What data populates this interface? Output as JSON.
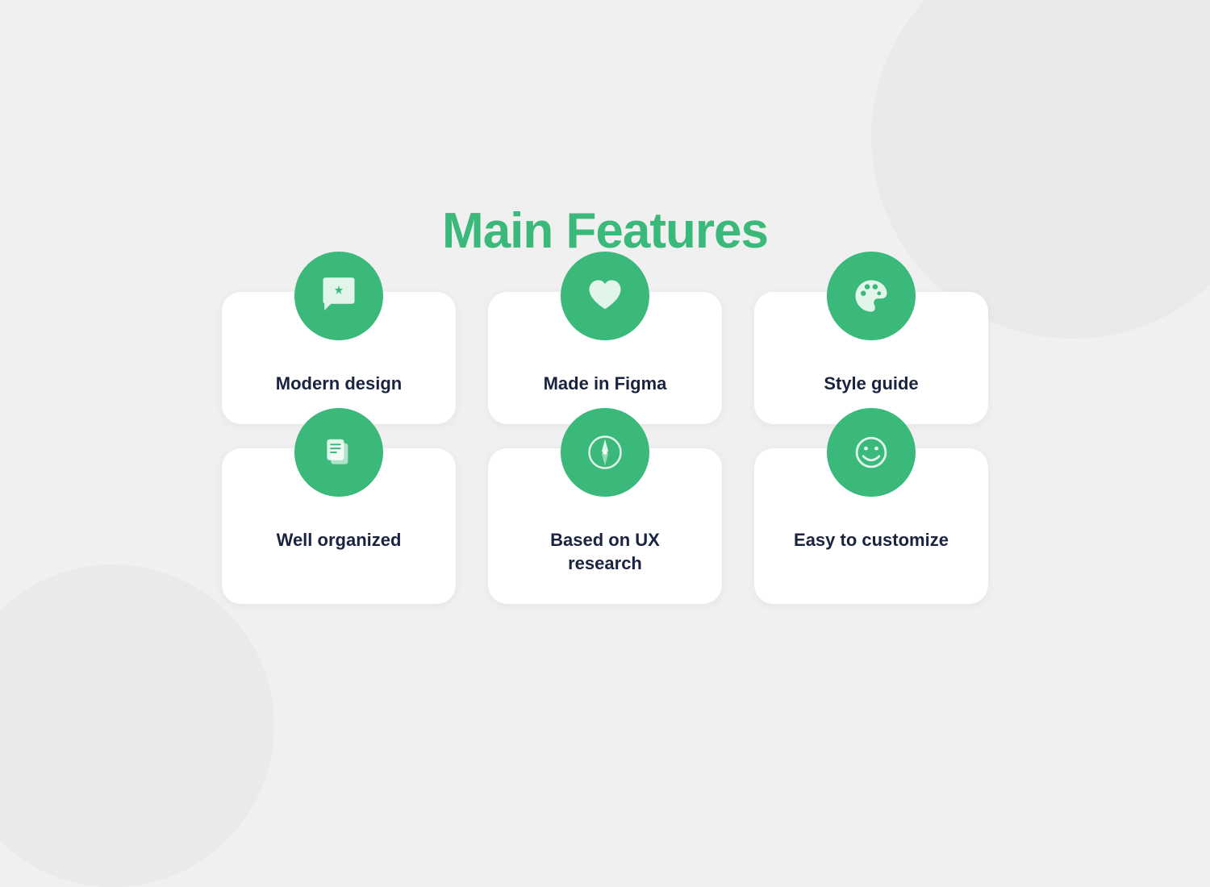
{
  "page": {
    "title": "Main Features",
    "accent_color": "#3ab97a",
    "features": [
      {
        "id": "modern-design",
        "label": "Modern design",
        "icon": "sparkle-chat"
      },
      {
        "id": "made-in-figma",
        "label": "Made in Figma",
        "icon": "heart"
      },
      {
        "id": "style-guide",
        "label": "Style guide",
        "icon": "palette"
      },
      {
        "id": "well-organized",
        "label": "Well organized",
        "icon": "copy"
      },
      {
        "id": "ux-research",
        "label": "Based on UX research",
        "icon": "compass"
      },
      {
        "id": "easy-customize",
        "label": "Easy to customize",
        "icon": "smiley"
      }
    ]
  }
}
